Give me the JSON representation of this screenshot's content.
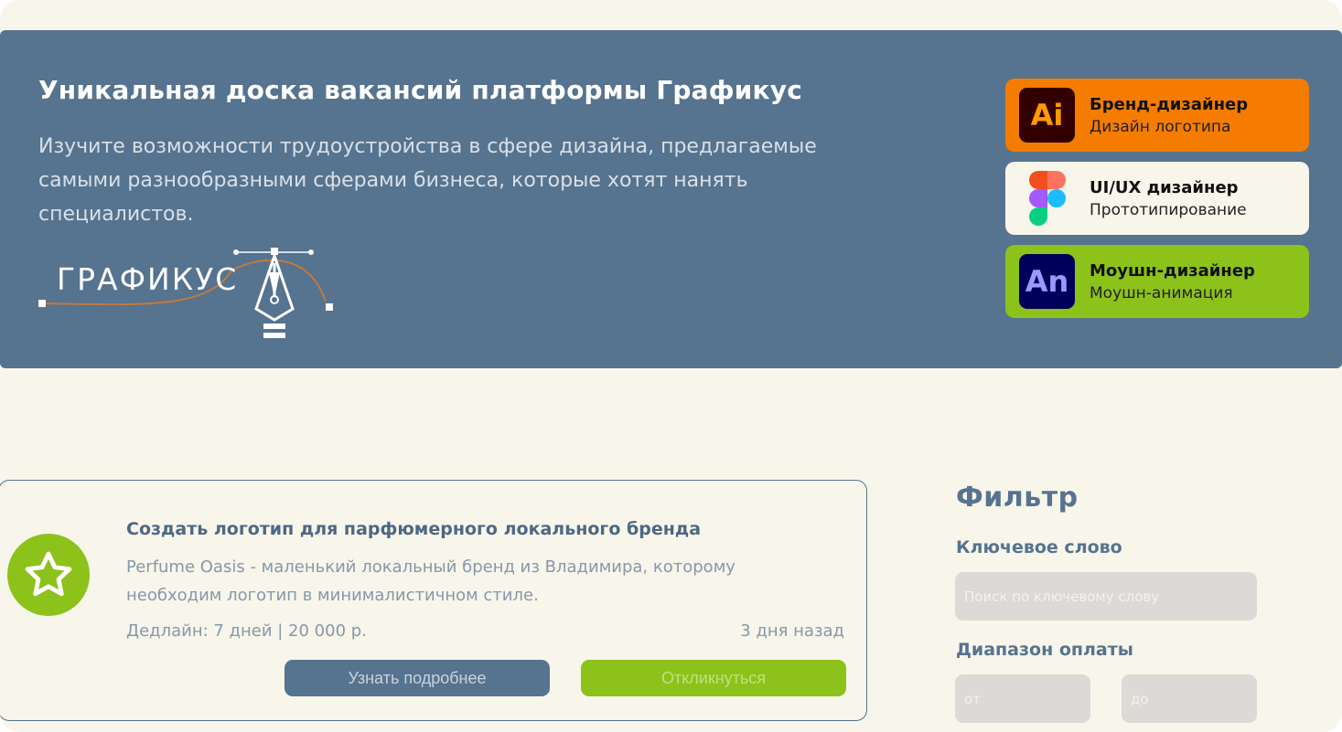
{
  "hero": {
    "title": "Уникальная доска вакансий платформы Графикус",
    "description": "Изучите возможности трудоустройства в сфере дизайна, предлагаемые самыми разнообразными сферами бизнеса, которые хотят нанять специалистов.",
    "logo_text": "ГРАФИКУС"
  },
  "roles": [
    {
      "title": "Бренд-дизайнер",
      "subtitle": "Дизайн логотипа",
      "icon": "adobe-illustrator-icon",
      "icon_text": "Ai",
      "bg": "#f57c00",
      "icon_bg": "#330000",
      "icon_fg": "#ff9a00"
    },
    {
      "title": "UI/UX дизайнер",
      "subtitle": "Прототипирование",
      "icon": "figma-icon",
      "bg": "#f8f5ea"
    },
    {
      "title": "Моушн-дизайнер",
      "subtitle": "Моушн-анимация",
      "icon": "adobe-animate-icon",
      "icon_text": "An",
      "bg": "#8cc21a",
      "icon_bg": "#00005b",
      "icon_fg": "#9999ff"
    }
  ],
  "job": {
    "title": "Создать логотип для парфюмерного локального бренда",
    "description": "Perfume Oasis - маленький локальный бренд из Владимира, которому необходим логотип в минималистичном стиле.",
    "meta": "Дедлайн: 7 дней | 20 000 р.",
    "age": "3 дня назад",
    "more_label": "Узнать подробнее",
    "apply_label": "Откликнуться",
    "icon": "star-icon"
  },
  "filter": {
    "title": "Фильтр",
    "keyword_label": "Ключевое слово",
    "keyword_placeholder": "Поиск по ключевому слову",
    "salary_label": "Диапазон оплаты",
    "from_placeholder": "от",
    "to_placeholder": "до"
  },
  "colors": {
    "hero_bg": "#56738f",
    "page_bg": "#f8f5ea",
    "accent_green": "#8cc21a",
    "accent_orange": "#f57c00"
  }
}
